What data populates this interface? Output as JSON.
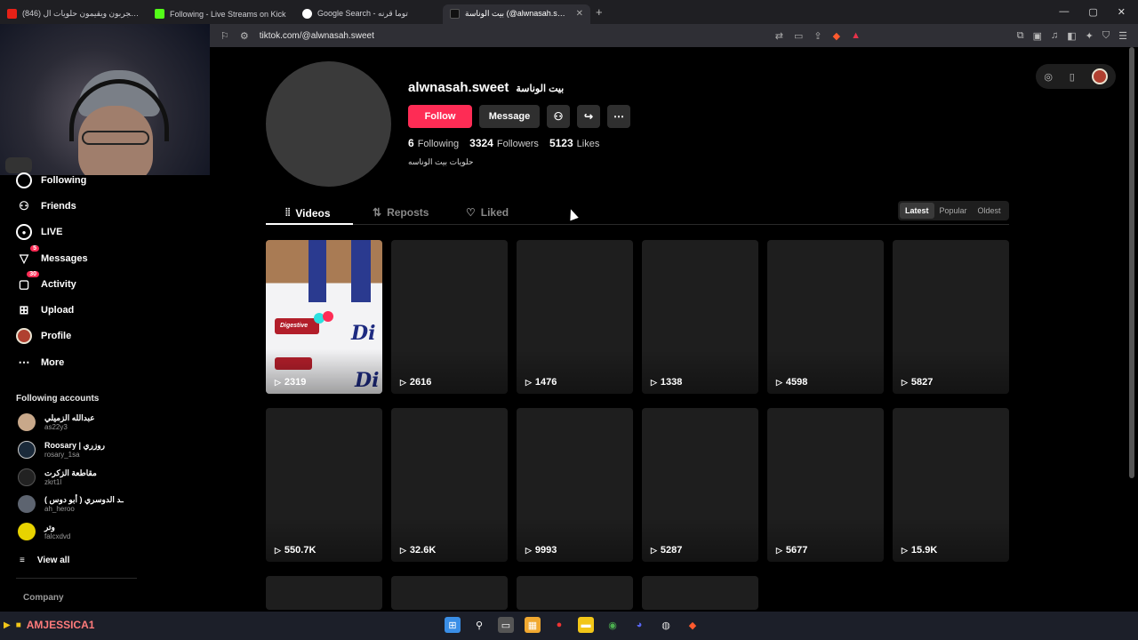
{
  "browser": {
    "tabs": [
      {
        "title": "(846) أمهات يجربون ويقيمون حلويات ال",
        "icon_color": "#e62117",
        "active": false
      },
      {
        "title": "Following - Live Streams on Kick",
        "icon_color": "#53fc18",
        "active": false
      },
      {
        "title": "Google Search - توما قرنه",
        "icon_color": "#ffffff",
        "active": false
      },
      {
        "title": "بيت الوناسة (@alwnasah.sweet) |",
        "icon_color": "#ffffff",
        "active": true
      }
    ],
    "new_tab": "+",
    "window_controls": {
      "min": "—",
      "max": "▢",
      "close": "✕"
    },
    "url": "tiktok.com/@alwnasah.sweet"
  },
  "sidebar": {
    "nav": [
      {
        "label": "Following",
        "icon": "following-icon",
        "badge": ""
      },
      {
        "label": "Friends",
        "icon": "friends-icon",
        "badge": ""
      },
      {
        "label": "LIVE",
        "icon": "live-icon",
        "badge": ""
      },
      {
        "label": "Messages",
        "icon": "messages-icon",
        "badge": "5"
      },
      {
        "label": "Activity",
        "icon": "activity-icon",
        "badge": "30"
      },
      {
        "label": "Upload",
        "icon": "upload-icon",
        "badge": ""
      },
      {
        "label": "Profile",
        "icon": "profile-avatar",
        "badge": ""
      },
      {
        "label": "More",
        "icon": "more-icon",
        "badge": ""
      }
    ],
    "following_accounts_title": "Following accounts",
    "accounts": [
      {
        "name": "عبدالله الزميلي",
        "handle": "as22y3",
        "color": "#c8a88a"
      },
      {
        "name": "Roosary | روزري",
        "handle": "rosary_1sa",
        "color": "#1b2a3a"
      },
      {
        "name": "مقاطعة الزكرت",
        "handle": "zkrt1l",
        "color": "#222222"
      },
      {
        "name": "ـد الدوسري ( أبو دوس )",
        "handle": "ah_heroo",
        "color": "#5d6470"
      },
      {
        "name": "وتر",
        "handle": "falcxdvd",
        "color": "#e8d300"
      }
    ],
    "view_all": "View all",
    "company": "Company"
  },
  "profile": {
    "username": "alwnasah.sweet",
    "display_name": "بيت الوناسة",
    "follow_label": "Follow",
    "message_label": "Message",
    "following_count": "6",
    "following_label": "Following",
    "followers_count": "3324",
    "followers_label": "Followers",
    "likes_count": "5123",
    "likes_label": "Likes",
    "bio": "حلويات بيت الوناسه"
  },
  "tabs": {
    "videos": "Videos",
    "reposts": "Reposts",
    "liked": "Liked"
  },
  "sort": {
    "latest": "Latest",
    "popular": "Popular",
    "oldest": "Oldest"
  },
  "videos": [
    {
      "views": "2319"
    },
    {
      "views": "2616"
    },
    {
      "views": "1476"
    },
    {
      "views": "1338"
    },
    {
      "views": "4598"
    },
    {
      "views": "5827"
    },
    {
      "views": "550.7K"
    },
    {
      "views": "32.6K"
    },
    {
      "views": "9993"
    },
    {
      "views": "5287"
    },
    {
      "views": "5677"
    },
    {
      "views": "15.9K"
    },
    {
      "views": ""
    },
    {
      "views": ""
    },
    {
      "views": ""
    },
    {
      "views": ""
    }
  ],
  "thumbnail_text": {
    "brand": "Digestive",
    "partial": "Di"
  },
  "taskbar": {
    "streamer": "AMJESSICA1",
    "colors": {
      "accent": "#fe2c55",
      "background": "#000000"
    }
  }
}
